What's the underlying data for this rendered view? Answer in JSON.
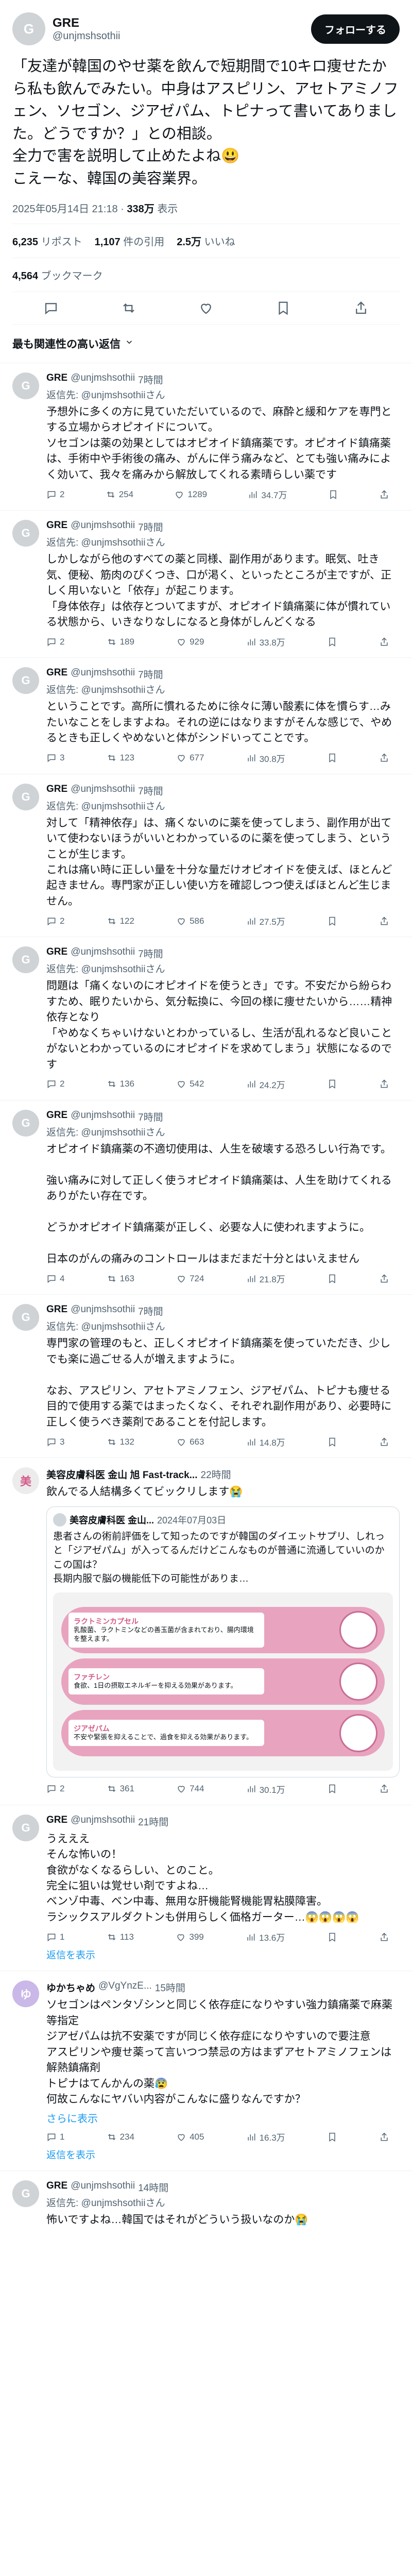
{
  "header": {
    "name": "GRE",
    "handle": "@unjmshsothii",
    "follow_label": "フォローする"
  },
  "tweet": {
    "text": "「友達が韓国のやせ薬を飲んで短期間で10キロ痩せたから私も飲んでみたい。中身はアスピリン、アセトアミノフェン、ソセゴン、ジアゼパム、トピナって書いてありました。どうですか？」との相談。\n全力で害を説明して止めたよね😃\nこえーな、韓国の美容業界。",
    "time": "2025年05月14日 21:18",
    "views": "338万",
    "views_label": "表示"
  },
  "stats": {
    "reposts": "6,235",
    "reposts_label": "リポスト",
    "quotes": "1,107",
    "quotes_label": "件の引用",
    "likes": "2.5万",
    "likes_label": "いいね",
    "bookmarks": "4,564",
    "bookmarks_label": "ブックマーク"
  },
  "sort_label": "最も関連性の高い返信",
  "replies": [
    {
      "name": "GRE",
      "handle": "@unjmshsothii",
      "time": "7時間",
      "reply_to": "返信先: @unjmshsothiiさん",
      "text": "予想外に多くの方に見ていただいているので、麻酔と緩和ケアを専門とする立場からオピオイドについて。\nソセゴンは薬の効果としてはオピオイド鎮痛薬です。オピオイド鎮痛薬は、手術中や手術後の痛み、がんに伴う痛みなど、とても強い痛みによく効いて、我々を痛みから解放してくれる素晴らしい薬です",
      "replies": "2",
      "reposts": "254",
      "likes": "1289",
      "views": "34.7万"
    },
    {
      "name": "GRE",
      "handle": "@unjmshsothii",
      "time": "7時間",
      "reply_to": "返信先: @unjmshsothiiさん",
      "text": "しかしながら他のすべての薬と同様、副作用があります。眠気、吐き気、便秘、筋肉のぴくつき、口が渇く、といったところが主ですが、正しく用いないと「依存」が起こります。\n「身体依存」は依存とついてますが、オピオイド鎮痛薬に体が慣れている状態から、いきなりなしになると身体がしんどくなる",
      "replies": "2",
      "reposts": "189",
      "likes": "929",
      "views": "33.8万"
    },
    {
      "name": "GRE",
      "handle": "@unjmshsothii",
      "time": "7時間",
      "reply_to": "返信先: @unjmshsothiiさん",
      "text": "ということです。高所に慣れるために徐々に薄い酸素に体を慣らす…みたいなことをしますよね。それの逆にはなりますがそんな感じで、やめるときも正しくやめないと体がシンドいってことです。",
      "replies": "3",
      "reposts": "123",
      "likes": "677",
      "views": "30.8万"
    },
    {
      "name": "GRE",
      "handle": "@unjmshsothii",
      "time": "7時間",
      "reply_to": "返信先: @unjmshsothiiさん",
      "text": "対して「精神依存」は、痛くないのに薬を使ってしまう、副作用が出ていて使わないほうがいいとわかっているのに薬を使ってしまう、ということが生じます。\nこれは痛い時に正しい量を十分な量だけオピオイドを使えば、ほとんど起きません。専門家が正しい使い方を確認しつつ使えばほとんど生じません。",
      "replies": "2",
      "reposts": "122",
      "likes": "586",
      "views": "27.5万"
    },
    {
      "name": "GRE",
      "handle": "@unjmshsothii",
      "time": "7時間",
      "reply_to": "返信先: @unjmshsothiiさん",
      "text": "問題は「痛くないのにオピオイドを使うとき」です。不安だから紛らわすため、眠りたいから、気分転換に、今回の様に痩せたいから……精神依存となり\n「やめなくちゃいけないとわかっているし、生活が乱れるなど良いことがないとわかっているのにオピオイドを求めてしまう」状態になるのです",
      "replies": "2",
      "reposts": "136",
      "likes": "542",
      "views": "24.2万"
    },
    {
      "name": "GRE",
      "handle": "@unjmshsothii",
      "time": "7時間",
      "reply_to": "返信先: @unjmshsothiiさん",
      "text": "オピオイド鎮痛薬の不適切使用は、人生を破壊する恐ろしい行為です。\n\n強い痛みに対して正しく使うオピオイド鎮痛薬は、人生を助けてくれるありがたい存在です。\n\nどうかオピオイド鎮痛薬が正しく、必要な人に使われますように。\n\n日本のがんの痛みのコントロールはまだまだ十分とはいえません",
      "replies": "4",
      "reposts": "163",
      "likes": "724",
      "views": "21.8万"
    },
    {
      "name": "GRE",
      "handle": "@unjmshsothii",
      "time": "7時間",
      "reply_to": "返信先: @unjmshsothiiさん",
      "text": "専門家の管理のもと、正しくオピオイド鎮痛薬を使っていただき、少しでも楽に過ごせる人が増えますように。\n\nなお、アスピリン、アセトアミノフェン、ジアゼパム、トピナも痩せる目的で使用する薬ではまったくなく、それぞれ副作用があり、必要時に正しく使うべき薬剤であることを付記します。",
      "replies": "3",
      "reposts": "132",
      "likes": "663",
      "views": "14.8万"
    }
  ],
  "reply_clinic": {
    "name": "美容皮膚科医 金山 旭 Fast-track...",
    "time": "22時間",
    "text": "飲んでる人結構多くてビックリします😭",
    "quote_name": "美容皮膚科医 金山...",
    "quote_date": "2024年07月03日",
    "quote_text": "患者さんの術前評価をして知ったのですが韓国のダイエットサプリ、しれっと「ジアゼパム」が入ってるんだけどこんなものが普通に流通していいのかこの国は？\n長期内服で脳の機能低下の可能性がありま…",
    "pills": [
      {
        "title": "ラクトミンカプセル",
        "desc": "乳酸菌、ラクトミンなどの善玉菌が含まれており、腸内環境を整えます。"
      },
      {
        "title": "ファチレン",
        "desc": "食欲、1日の摂取エネルギーを抑える効果があります。"
      },
      {
        "title": "ジアゼパム",
        "desc": "不安や緊張を抑えることで、過食を抑える効果があります。"
      }
    ],
    "replies": "2",
    "reposts": "361",
    "likes": "744",
    "views": "30.1万"
  },
  "reply_other1": {
    "name": "GRE",
    "handle": "@unjmshsothii",
    "time": "21時間",
    "text": "うえええ\nそんな怖いの！\n食欲がなくなるらしい、とのこと。\n完全に狙いは覚せい剤ですよね…\nベンゾ中毒、ベン中毒、無用な肝機能腎機能胃粘膜障害。\nラシックスアルダクトンも併用らしく価格ガーター…😱😱😱😱",
    "replies": "1",
    "reposts": "113",
    "likes": "399",
    "views": "13.6万",
    "show_more": "返信を表示"
  },
  "reply_other2": {
    "name": "ゆかちゃめ",
    "handle": "@VgYnzE...",
    "time": "15時間",
    "text": "ソセゴンはペンタゾシンと同じく依存症になりやすい強力鎮痛薬で麻薬等指定\nジアゼパムは抗不安薬ですが同じく依存症になりやすいので要注意\nアスピリンや痩せ薬って言いつつ禁忌の方はまずアセトアミノフェンは解熱鎮痛剤\nトピナはてんかんの薬😰\n何故こんなにヤバい内容がこんなに盛りなんですか？",
    "more": "さらに表示",
    "replies": "1",
    "reposts": "234",
    "likes": "405",
    "views": "16.3万",
    "show_more": "返信を表示"
  },
  "reply_last": {
    "name": "GRE",
    "handle": "@unjmshsothii",
    "time": "14時間",
    "reply_to": "返信先: @unjmshsothiiさん",
    "text": "怖いですよね…韓国ではそれがどういう扱いなのか😭"
  },
  "colors": {
    "accent": "#1d9bf0",
    "text": "#0f1419",
    "muted": "#536471",
    "pill": "#e8a3bf"
  },
  "icons": [
    "reply-icon",
    "repost-icon",
    "like-icon",
    "views-icon",
    "bookmark-icon",
    "share-icon",
    "chevron-down-icon",
    "more-icon"
  ]
}
